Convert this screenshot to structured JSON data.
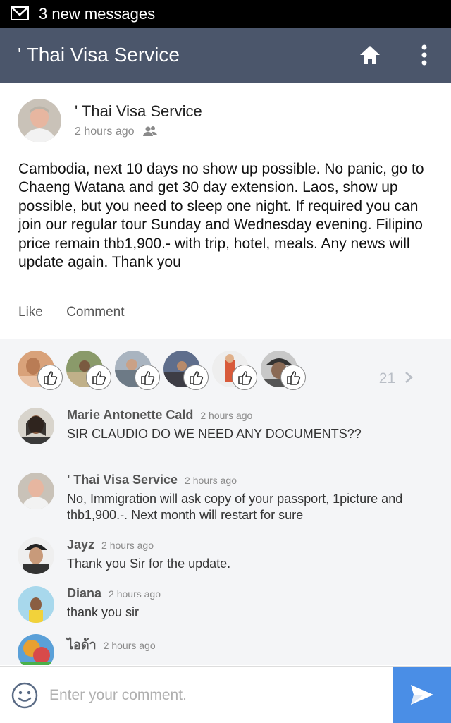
{
  "status_bar": {
    "notification": "3 new messages",
    "icon": "gmail-icon"
  },
  "app_bar": {
    "title": "' Thai Visa Service",
    "icons": [
      "home-icon",
      "more-vert-icon"
    ]
  },
  "post": {
    "author": "' Thai Visa Service",
    "time": "2 hours ago",
    "audience_icon": "friends-icon",
    "text": "Cambodia, next 10 days no show up possible. No panic, go to Chaeng Watana and get 30 day extension. Laos, show up possible, but you need to sleep one night. If required you can join our regular tour Sunday and Wednesday evening. Filipino price remain thb1,900.- with trip, hotel, meals. Any news will update again. Thank you",
    "actions": {
      "like": "Like",
      "comment": "Comment"
    }
  },
  "likes": {
    "count": "21",
    "chevron_icon": "chevron-right-icon",
    "reaction_icon": "thumbs-up-icon"
  },
  "comments": [
    {
      "name": "Marie Antonette Cald",
      "time": "2 hours ago",
      "text": "SIR CLAUDIO DO WE NEED ANY DOCUMENTS??"
    },
    {
      "name": "' Thai Visa Service",
      "time": "2 hours ago",
      "text": "No, Immigration will ask copy of your passport, 1picture and thb1,900.-. Next month will restart for sure"
    },
    {
      "name": "Jayz",
      "time": "2 hours ago",
      "text": "Thank you Sir for the update."
    },
    {
      "name": "Diana",
      "time": "2 hours ago",
      "text": "thank you  sir"
    },
    {
      "name": "ไอด้า",
      "time": "2 hours ago",
      "text": ""
    }
  ],
  "input": {
    "placeholder": "Enter your comment.",
    "value": ""
  },
  "colors": {
    "app_bar": "#4b566b",
    "send_button": "#4a8ee6",
    "comments_bg": "#f4f5f7"
  }
}
